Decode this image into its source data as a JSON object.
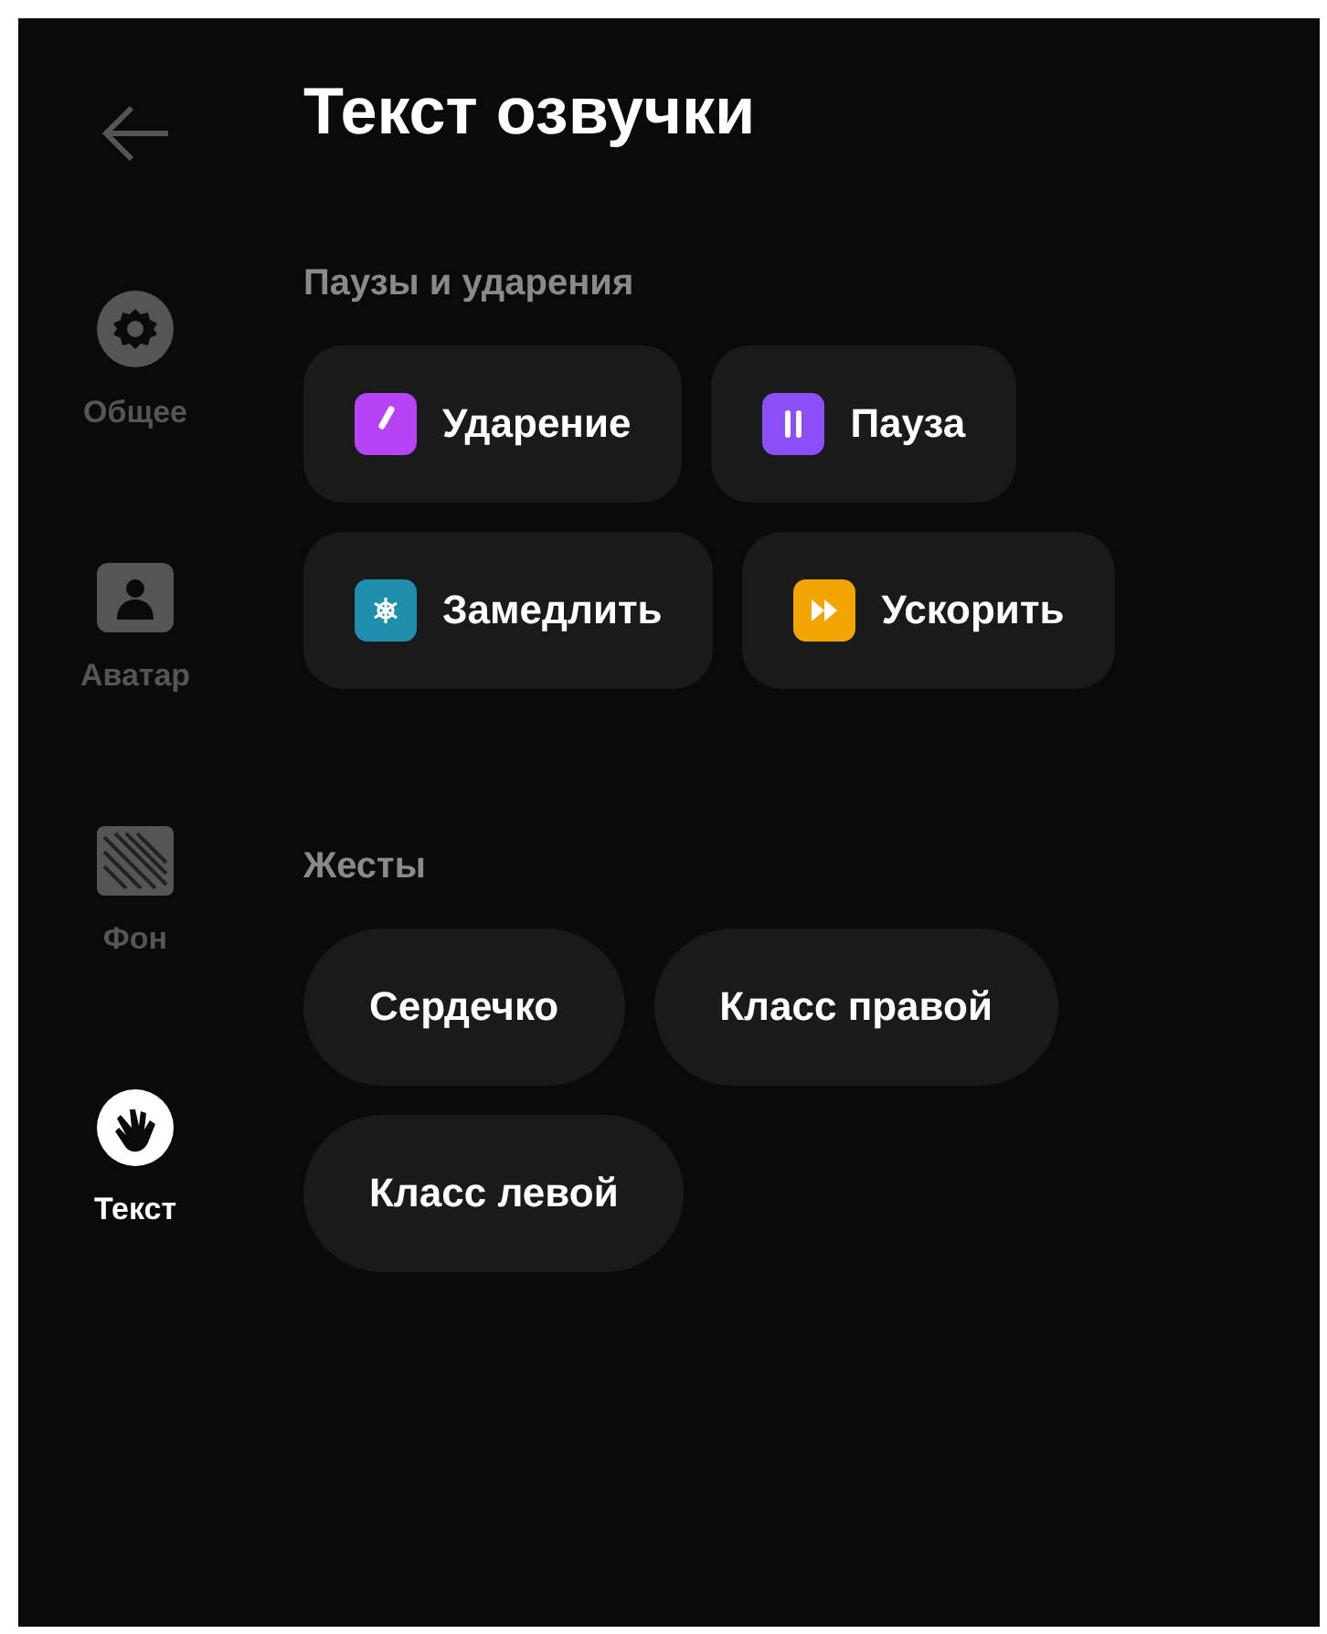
{
  "sidebar": {
    "items": [
      {
        "label": "Общее",
        "kind": "gear",
        "selected": false
      },
      {
        "label": "Аватар",
        "kind": "person",
        "selected": false
      },
      {
        "label": "Фон",
        "kind": "stripes",
        "selected": false
      },
      {
        "label": "Текст",
        "kind": "hand",
        "selected": true
      }
    ]
  },
  "title": "Текст озвучки",
  "sections": [
    {
      "heading": "Паузы и ударения",
      "kind": "effects",
      "items": [
        {
          "label": "Ударение",
          "kind": "stress",
          "color": "#b643f5"
        },
        {
          "label": "Пауза",
          "kind": "pause",
          "color": "#8b4ff7"
        },
        {
          "label": "Замедлить",
          "kind": "slow",
          "color": "#1f8fad"
        },
        {
          "label": "Ускорить",
          "kind": "fast",
          "color": "#f2a500"
        }
      ]
    },
    {
      "heading": "Жесты",
      "kind": "gestures",
      "items": [
        {
          "label": "Сердечко"
        },
        {
          "label": "Класс правой"
        },
        {
          "label": "Класс левой"
        }
      ]
    }
  ]
}
